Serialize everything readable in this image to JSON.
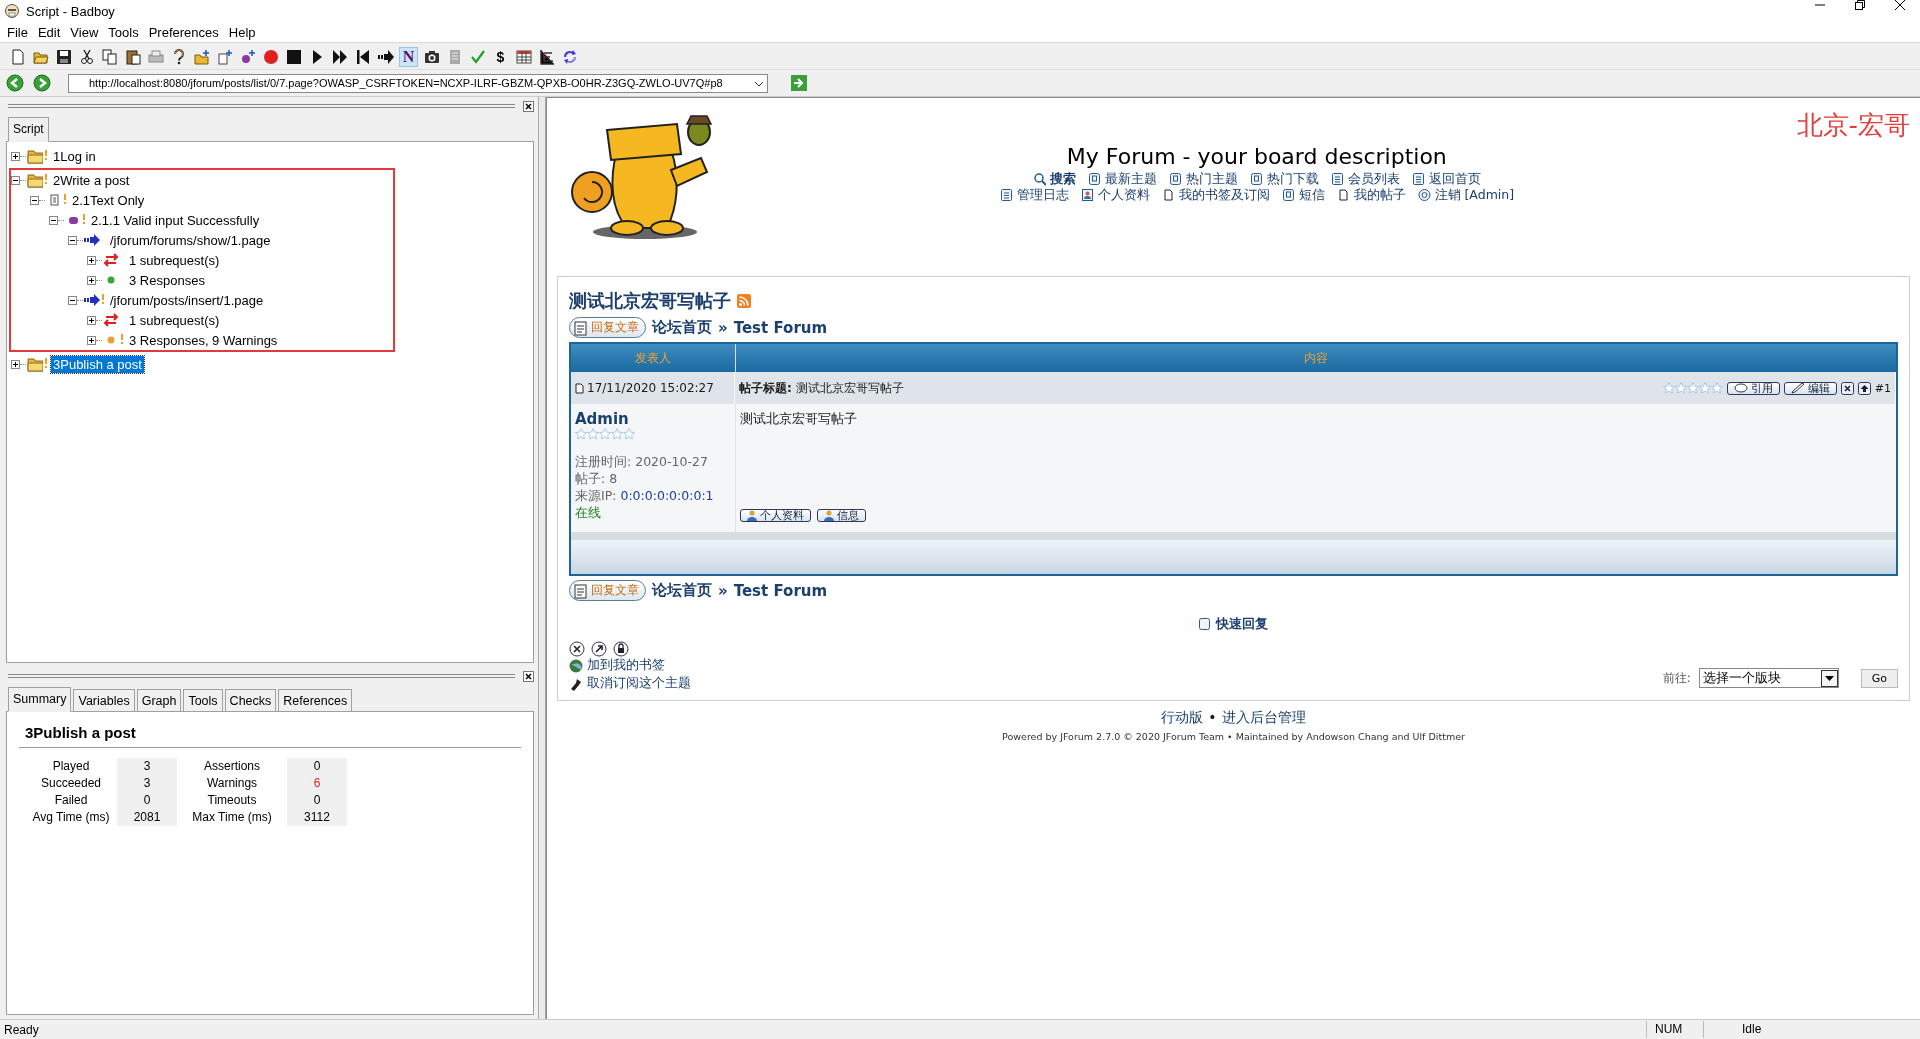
{
  "window": {
    "title": "Script - Badboy"
  },
  "menu": [
    "File",
    "Edit",
    "View",
    "Tools",
    "Preferences",
    "Help"
  ],
  "toolbar": [
    {
      "kind": "new",
      "selected": false
    },
    {
      "kind": "open",
      "selected": false
    },
    {
      "kind": "save",
      "selected": false
    },
    {
      "kind": "cut",
      "selected": false
    },
    {
      "kind": "copy",
      "selected": false
    },
    {
      "kind": "paste",
      "selected": false
    },
    {
      "kind": "print",
      "selected": false
    },
    {
      "kind": "help",
      "selected": false
    },
    {
      "kind": "add-folder",
      "selected": false
    },
    {
      "kind": "add-step",
      "selected": false
    },
    {
      "kind": "add-test",
      "selected": false
    },
    {
      "kind": "record",
      "selected": false
    },
    {
      "kind": "stop",
      "selected": false
    },
    {
      "kind": "play",
      "selected": false
    },
    {
      "kind": "play-all",
      "selected": false
    },
    {
      "kind": "rewind",
      "selected": false
    },
    {
      "kind": "step",
      "selected": false
    },
    {
      "kind": "text",
      "label": "N",
      "selected": true
    },
    {
      "kind": "camera",
      "selected": false
    },
    {
      "kind": "document",
      "selected": false
    },
    {
      "kind": "check",
      "selected": false
    },
    {
      "kind": "text",
      "label": "$",
      "selected": false
    },
    {
      "kind": "table",
      "selected": false
    },
    {
      "kind": "tree",
      "selected": false
    },
    {
      "kind": "refresh",
      "selected": false
    }
  ],
  "url": {
    "value": "http://localhost:8080/jforum/posts/list/0/7.page?OWASP_CSRFTOKEN=NCXP-ILRF-GBZM-QPXB-O0HR-Z3GQ-ZWLO-UV7Q#p8"
  },
  "script_panel": {
    "tab": "Script",
    "tree": [
      {
        "label": "1Log in",
        "kind": "folder",
        "expanded": false,
        "warning": true,
        "selected": false,
        "highlighted": false
      },
      {
        "label": "2Write a post",
        "kind": "folder",
        "expanded": true,
        "warning": true,
        "selected": false,
        "highlighted": true,
        "children": [
          {
            "label": "2.1Text Only",
            "kind": "step",
            "expanded": true,
            "warning": true,
            "selected": false,
            "children": [
              {
                "label": "2.1.1 Valid input Successfully",
                "kind": "test",
                "expanded": true,
                "warning": true,
                "selected": false,
                "children": [
                  {
                    "label": "/jforum/forums/show/1.page",
                    "kind": "request",
                    "expanded": true,
                    "warning": false,
                    "selected": false,
                    "children": [
                      {
                        "label": "1 subrequest(s)",
                        "kind": "subrequest",
                        "expanded": false,
                        "warning": false,
                        "selected": false
                      },
                      {
                        "label": "3 Responses",
                        "kind": "response",
                        "color": "#3aa53a",
                        "expanded": false,
                        "warning": false,
                        "selected": false
                      }
                    ]
                  },
                  {
                    "label": "/jforum/posts/insert/1.page",
                    "kind": "request",
                    "expanded": true,
                    "warning": true,
                    "selected": false,
                    "children": [
                      {
                        "label": "1 subrequest(s)",
                        "kind": "subrequest",
                        "expanded": false,
                        "warning": false,
                        "selected": false
                      },
                      {
                        "label": "3 Responses, 9 Warnings",
                        "kind": "response",
                        "color": "#f0a030",
                        "expanded": false,
                        "warning": true,
                        "selected": false
                      }
                    ]
                  }
                ]
              }
            ]
          }
        ]
      },
      {
        "label": "3Publish a post",
        "kind": "folder",
        "expanded": false,
        "warning": true,
        "selected": true,
        "highlighted": false
      }
    ]
  },
  "summary_panel": {
    "tabs": [
      {
        "label": "Summary",
        "selected": true
      },
      {
        "label": "Variables",
        "selected": false
      },
      {
        "label": "Graph",
        "selected": false
      },
      {
        "label": "Tools",
        "selected": false
      },
      {
        "label": "Checks",
        "selected": false
      },
      {
        "label": "References",
        "selected": false
      }
    ],
    "title": "3Publish a post",
    "stats": [
      {
        "label": "Played",
        "value": "3",
        "alert": false
      },
      {
        "label": "Assertions",
        "value": "0",
        "alert": false
      },
      {
        "label": "Succeeded",
        "value": "3",
        "alert": false
      },
      {
        "label": "Warnings",
        "value": "6",
        "alert": true
      },
      {
        "label": "Failed",
        "value": "0",
        "alert": false
      },
      {
        "label": "Timeouts",
        "value": "0",
        "alert": false
      },
      {
        "label": "Avg Time (ms)",
        "value": "2081",
        "alert": false
      },
      {
        "label": "Max Time (ms)",
        "value": "3112",
        "alert": false
      }
    ]
  },
  "browser": {
    "header": {
      "title": "My Forum - your board description",
      "annotation": "北京-宏哥",
      "nav": [
        [
          {
            "label": "搜索",
            "kind": "search",
            "bold": true
          },
          {
            "label": "最新主题",
            "kind": "doc",
            "bold": false
          },
          {
            "label": "热门主题",
            "kind": "doc",
            "bold": false
          },
          {
            "label": "热门下载",
            "kind": "doc",
            "bold": false
          },
          {
            "label": "会员列表",
            "kind": "list",
            "bold": false
          },
          {
            "label": "返回首页",
            "kind": "list",
            "bold": false
          }
        ],
        [
          {
            "label": "管理日志",
            "kind": "list",
            "bold": false
          },
          {
            "label": "个人资料",
            "kind": "profile",
            "bold": false
          },
          {
            "label": "我的书签及订阅",
            "kind": "page",
            "bold": false
          },
          {
            "label": "短信",
            "kind": "doc",
            "bold": false
          },
          {
            "label": "我的帖子",
            "kind": "page",
            "bold": false
          },
          {
            "label": "注销 [Admin]",
            "kind": "power",
            "bold": false
          }
        ]
      ]
    },
    "topic": {
      "title": "测试北京宏哥写帖子",
      "top_nav": {
        "reply_button": "回复文章",
        "home": "论坛首页",
        "separator": "»",
        "forum": "Test Forum"
      },
      "table": {
        "columns": [
          "发表人",
          "内容"
        ],
        "post": {
          "date": "17/11/2020 15:02:27",
          "subject": "**帖子标题:** 测试北京宏哥写帖子",
          "stars": 0,
          "buttons": [
            "引用",
            "编辑"
          ],
          "number": "#1",
          "author": {
            "name": "Admin",
            "stars": 0,
            "registered": "注册时间: 2020-10-27",
            "posts": "帖子: 8",
            "ip_label": "来源IP:",
            "ip": "0:0:0:0:0:0:0:1",
            "status": "在线"
          },
          "body": "测试北京宏哥写帖子",
          "profile_buttons": [
            "个人资料",
            "信息"
          ]
        }
      },
      "bottom_nav": {
        "reply_button": "回复文章",
        "home": "论坛首页",
        "separator": "»",
        "forum": "Test Forum"
      },
      "quick_reply": "快速回复",
      "links": [
        "加到我的书签",
        "取消订阅这个主题"
      ],
      "jump": {
        "label": "前往:",
        "value": "选择一个版块",
        "button": "Go"
      }
    },
    "footer": {
      "links": [
        "行动版",
        "进入后台管理"
      ],
      "separator": "•",
      "powered": "Powered by JForum 2.7.0 © 2020 JForum Team • Maintained by Andowson Chang and Ulf Dittmer"
    }
  },
  "status_bar": {
    "message": "Ready",
    "num": "NUM",
    "state": "Idle"
  }
}
